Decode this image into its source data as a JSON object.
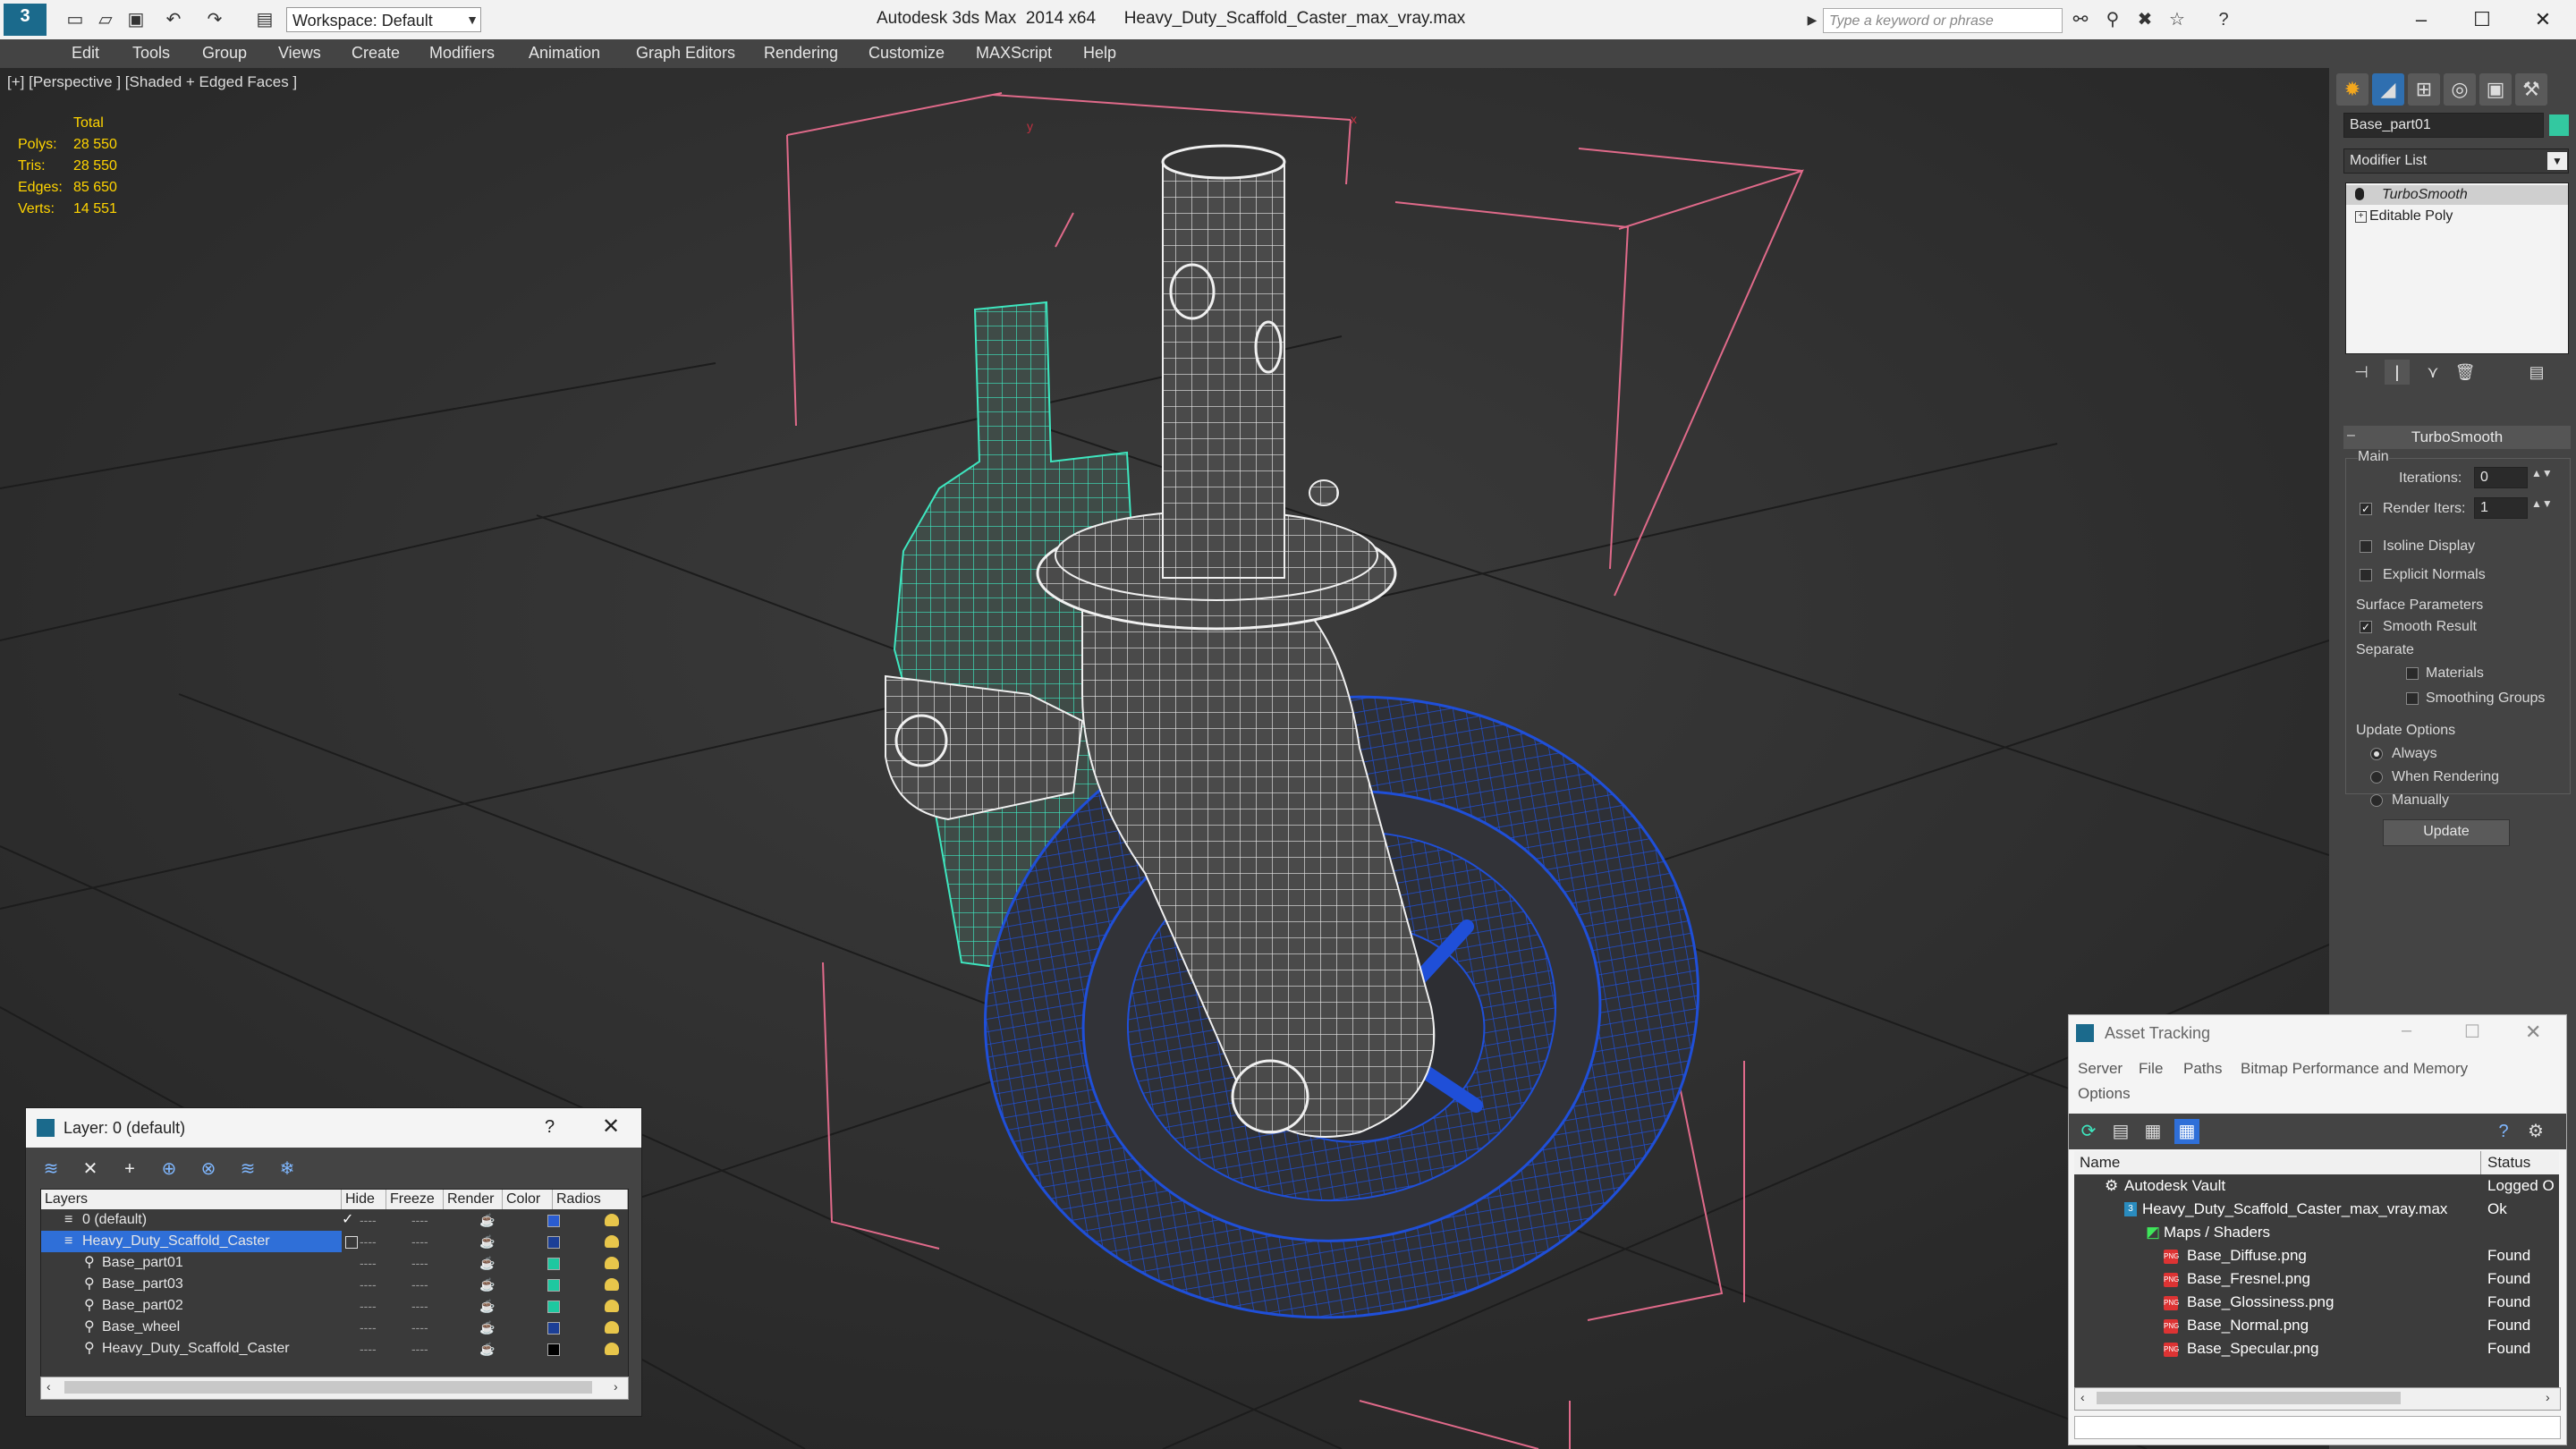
{
  "titlebar": {
    "title": "Autodesk 3ds Max  2014 x64      Heavy_Duty_Scaffold_Caster_max_vray.max",
    "workspace": "Workspace: Default",
    "search_placeholder": "Type a keyword or phrase"
  },
  "menu": [
    "Edit",
    "Tools",
    "Group",
    "Views",
    "Create",
    "Modifiers",
    "Animation",
    "Graph Editors",
    "Rendering",
    "Customize",
    "MAXScript",
    "Help"
  ],
  "viewport": {
    "label": "[+] [Perspective ] [Shaded + Edged Faces ]",
    "stats": {
      "header": "Total",
      "rows": [
        {
          "label": "Polys:",
          "value": "28 550"
        },
        {
          "label": "Tris:",
          "value": "28 550"
        },
        {
          "label": "Edges:",
          "value": "85 650"
        },
        {
          "label": "Verts:",
          "value": "14 551"
        }
      ]
    }
  },
  "command_panel": {
    "object_name": "Base_part01",
    "object_color": "#33c8a0",
    "modifier_list": "Modifier List",
    "stack": [
      "TurboSmooth",
      "Editable Poly"
    ],
    "turbosmooth": {
      "header": "TurboSmooth",
      "main": "Main",
      "iterations_label": "Iterations:",
      "iterations_value": "0",
      "render_iters_label": "Render Iters:",
      "render_iters_value": "1",
      "isoline": "Isoline Display",
      "explicit": "Explicit Normals",
      "surface_params": "Surface Parameters",
      "smooth_result": "Smooth Result",
      "separate": "Separate",
      "materials": "Materials",
      "smoothing_groups": "Smoothing Groups",
      "update_options": "Update Options",
      "always": "Always",
      "when_rendering": "When Rendering",
      "manually": "Manually",
      "update_btn": "Update"
    }
  },
  "layer_window": {
    "title": "Layer: 0 (default)",
    "help": "?",
    "columns": [
      "Layers",
      "Hide",
      "Freeze",
      "Render",
      "Color",
      "Radios"
    ],
    "rows": [
      {
        "name": "0 (default)",
        "color": "#2a5cd0"
      },
      {
        "name": "Heavy_Duty_Scaffold_Caster",
        "color": "#1c3f96"
      },
      {
        "name": "Base_part01",
        "color": "#1ec8a0"
      },
      {
        "name": "Base_part03",
        "color": "#1ec8a0"
      },
      {
        "name": "Base_part02",
        "color": "#1ec8a0"
      },
      {
        "name": "Base_wheel",
        "color": "#1c3f96"
      },
      {
        "name": "Heavy_Duty_Scaffold_Caster",
        "color": "#000000"
      }
    ]
  },
  "asset_window": {
    "title": "Asset Tracking",
    "menu": [
      "Server",
      "File",
      "Paths",
      "Bitmap Performance and Memory",
      "Options"
    ],
    "columns": [
      "Name",
      "Status"
    ],
    "rows": [
      {
        "name": "Autodesk Vault",
        "status": "Logged O"
      },
      {
        "name": "Heavy_Duty_Scaffold_Caster_max_vray.max",
        "status": "Ok"
      },
      {
        "name": "Maps / Shaders",
        "status": ""
      },
      {
        "name": "Base_Diffuse.png",
        "status": "Found"
      },
      {
        "name": "Base_Fresnel.png",
        "status": "Found"
      },
      {
        "name": "Base_Glossiness.png",
        "status": "Found"
      },
      {
        "name": "Base_Normal.png",
        "status": "Found"
      },
      {
        "name": "Base_Specular.png",
        "status": "Found"
      }
    ]
  }
}
